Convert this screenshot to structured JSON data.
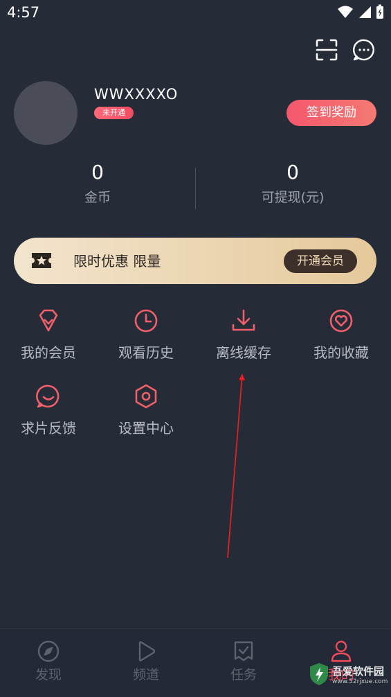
{
  "status": {
    "time": "4:57"
  },
  "profile": {
    "username": "WWXXXXO",
    "vip_status": "未开通",
    "checkin_label": "签到奖励"
  },
  "stats": [
    {
      "value": "0",
      "label": "金币"
    },
    {
      "value": "0",
      "label": "可提现(元)"
    }
  ],
  "banner": {
    "text": "限时优惠 限量",
    "button_label": "开通会员"
  },
  "grid": [
    {
      "label": "我的会员",
      "icon": "diamond-icon"
    },
    {
      "label": "观看历史",
      "icon": "clock-icon"
    },
    {
      "label": "离线缓存",
      "icon": "download-icon"
    },
    {
      "label": "我的收藏",
      "icon": "heart-icon"
    },
    {
      "label": "求片反馈",
      "icon": "feedback-icon"
    },
    {
      "label": "设置中心",
      "icon": "settings-icon"
    }
  ],
  "nav": [
    {
      "label": "发现",
      "icon": "compass-icon",
      "active": false
    },
    {
      "label": "频道",
      "icon": "play-icon",
      "active": false
    },
    {
      "label": "任务",
      "icon": "task-icon",
      "active": false
    },
    {
      "label": "我的",
      "icon": "user-icon",
      "active": true
    }
  ],
  "watermark": {
    "text": "吾爱软件园",
    "sub": "www.52rjxue.com"
  },
  "colors": {
    "background": "#262b38",
    "accent": "#f04a5a",
    "gold": "#e5c99b"
  }
}
